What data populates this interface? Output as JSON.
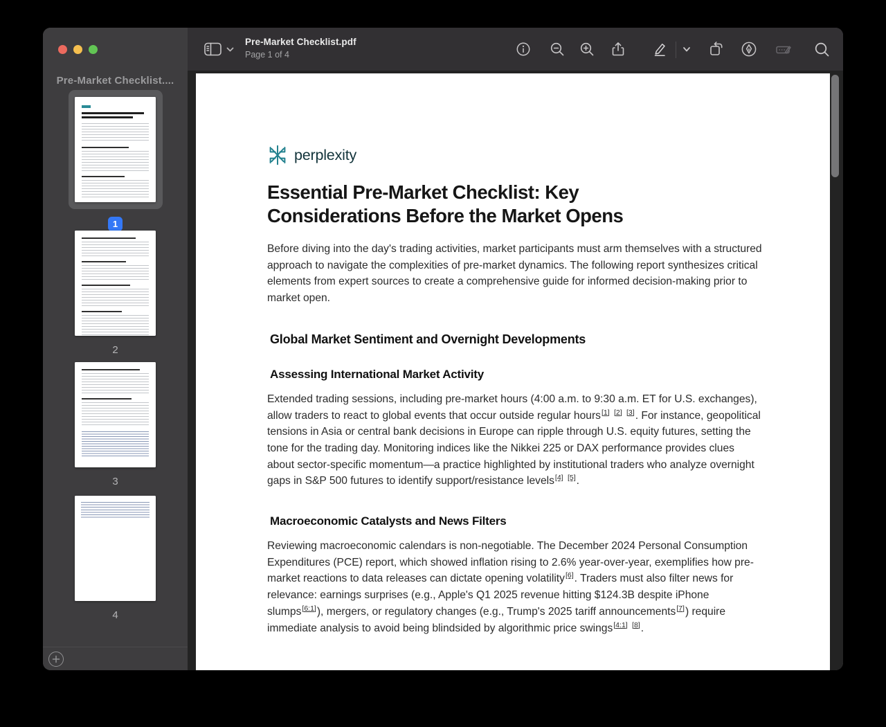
{
  "colors": {
    "accent_blue": "#3478F6",
    "brand_teal": "#20808D",
    "brand_text": "#13343B",
    "traffic_red": "#EC6A5E",
    "traffic_yellow": "#F5BF4F",
    "traffic_green": "#62C554"
  },
  "toolbar": {
    "title": "Pre-Market Checklist.pdf",
    "subtitle": "Page 1 of 4",
    "left_icons": [
      "sidebar-toggle-icon",
      "sidebar-options-chevron-icon"
    ],
    "right_icons": [
      {
        "name": "info-icon",
        "disabled": false
      },
      {
        "name": "zoom-out-icon",
        "disabled": false
      },
      {
        "name": "zoom-in-icon",
        "disabled": false
      },
      {
        "name": "share-icon",
        "disabled": false
      },
      {
        "name": "markup-pencil-icon",
        "disabled": false
      },
      {
        "name": "markup-chevron-icon",
        "disabled": false
      },
      {
        "name": "rotate-icon",
        "disabled": false
      },
      {
        "name": "pen-tool-icon",
        "disabled": false
      },
      {
        "name": "fill-and-sign-icon",
        "disabled": true
      },
      {
        "name": "search-icon",
        "disabled": false
      }
    ]
  },
  "sidebar": {
    "header": "Pre-Market Checklist....",
    "add_button_icon": "plus-circle-icon",
    "thumbnails": [
      {
        "number": "1",
        "selected": true
      },
      {
        "number": "2",
        "selected": false
      },
      {
        "number": "3",
        "selected": false
      },
      {
        "number": "4",
        "selected": false
      }
    ]
  },
  "document": {
    "brand": "perplexity",
    "brand_icon": "perplexity-logo-icon",
    "title": "Essential Pre-Market Checklist: Key Considerations Before the Market Opens",
    "blocks": [
      {
        "type": "p",
        "text": "Before diving into the day's trading activities, market participants must arm themselves with a structured approach to navigate the complexities of pre-market dynamics. The following report synthesizes critical elements from expert sources to create a comprehensive guide for informed decision-making prior to market open."
      },
      {
        "type": "h2",
        "text": "Global Market Sentiment and Overnight Developments"
      },
      {
        "type": "h3",
        "text": "Assessing International Market Activity"
      },
      {
        "type": "p",
        "text": "Extended trading sessions, including pre-market hours (4:00 a.m. to 9:30 a.m. ET for U.S. exchanges), allow traders to react to global events that occur outside regular hours[[1]] [[2]] [[3]]. For instance, geopolitical tensions in Asia or central bank decisions in Europe can ripple through U.S. equity futures, setting the tone for the trading day. Monitoring indices like the Nikkei 225 or DAX performance provides clues about sector-specific momentum—a practice highlighted by institutional traders who analyze overnight gaps in S&P 500 futures to identify support/resistance levels[[4]] [[5]]."
      },
      {
        "type": "h3",
        "text": "Macroeconomic Catalysts and News Filters"
      },
      {
        "type": "p",
        "text": "Reviewing macroeconomic calendars is non-negotiable. The December 2024 Personal Consumption Expenditures (PCE) report, which showed inflation rising to 2.6% year-over-year, exemplifies how pre-market reactions to data releases can dictate opening volatility[[6]]. Traders must also filter news for relevance: earnings surprises (e.g., Apple's Q1 2025 revenue hitting $124.3B despite iPhone slumps[[6:1]]), mergers, or regulatory changes (e.g., Trump's 2025 tariff announcements[[7]]) require immediate analysis to avoid being blindsided by algorithmic price swings[[4:1]] [[8]]."
      }
    ]
  }
}
